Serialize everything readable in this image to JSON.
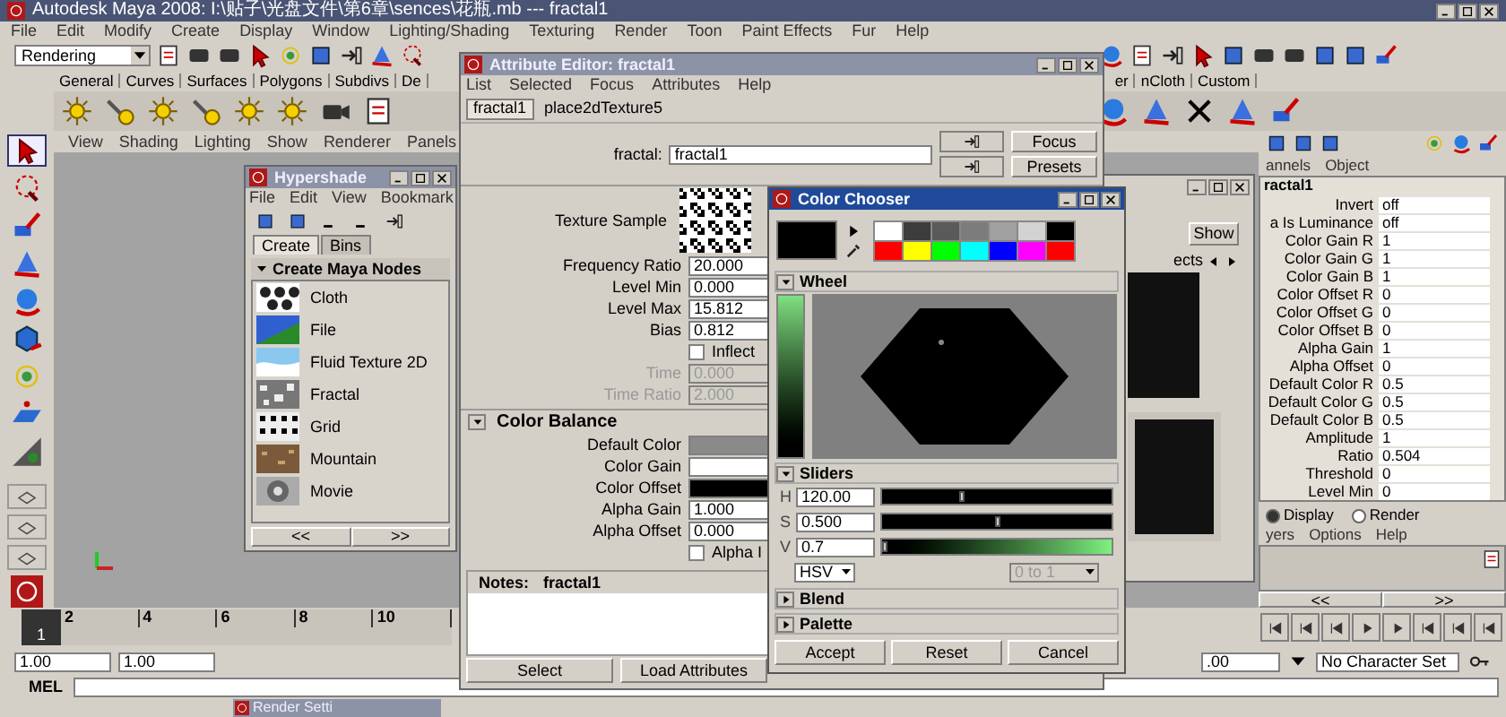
{
  "window": {
    "title": "Autodesk Maya 2008: I:\\贴子\\光盘文件\\第6章\\sences\\花瓶.mb  ---  fractal1"
  },
  "menu": [
    "File",
    "Edit",
    "Modify",
    "Create",
    "Display",
    "Window",
    "Lighting/Shading",
    "Texturing",
    "Render",
    "Toon",
    "Paint Effects",
    "Fur",
    "Help"
  ],
  "menu_set": {
    "value": "Rendering"
  },
  "shelf_tabs": [
    "General",
    "Curves",
    "Surfaces",
    "Polygons",
    "Subdivs",
    "De"
  ],
  "shelf_tabs_right": [
    "er",
    "nCloth",
    "Custom"
  ],
  "panel_menu": [
    "View",
    "Shading",
    "Lighting",
    "Show",
    "Renderer",
    "Panels"
  ],
  "hypershade": {
    "title": "Hypershade",
    "menu": [
      "File",
      "Edit",
      "View",
      "Bookmark"
    ],
    "tabs": [
      {
        "label": "Create",
        "selected": true
      },
      {
        "label": "Bins",
        "selected": false
      }
    ],
    "section": "Create Maya Nodes",
    "nodes": [
      {
        "label": "Cloth",
        "kind": "cloth"
      },
      {
        "label": "File",
        "kind": "file"
      },
      {
        "label": "Fluid Texture 2D",
        "kind": "fluid"
      },
      {
        "label": "Fractal",
        "kind": "fractal"
      },
      {
        "label": "Grid",
        "kind": "grid"
      },
      {
        "label": "Mountain",
        "kind": "mountain"
      },
      {
        "label": "Movie",
        "kind": "movie"
      }
    ],
    "pager": [
      "<<",
      ">>"
    ]
  },
  "attribute_editor": {
    "title": "Attribute Editor: fractal1",
    "menu": [
      "List",
      "Selected",
      "Focus",
      "Attributes",
      "Help"
    ],
    "tabs": [
      {
        "label": "fractal1",
        "selected": true
      },
      {
        "label": "place2dTexture5",
        "selected": false
      }
    ],
    "node_field": {
      "label": "fractal:",
      "value": "fractal1"
    },
    "buttons": [
      "Focus",
      "Presets"
    ],
    "texture_sample": "Texture Sample",
    "attributes": [
      {
        "kind": "field",
        "label": "Frequency Ratio",
        "value": "20.000",
        "disabled": false
      },
      {
        "kind": "field",
        "label": "Level Min",
        "value": "0.000",
        "disabled": false
      },
      {
        "kind": "field",
        "label": "Level Max",
        "value": "15.812",
        "disabled": false
      },
      {
        "kind": "field",
        "label": "Bias",
        "value": "0.812",
        "disabled": false
      },
      {
        "kind": "checkbox",
        "label": "Inflect",
        "checked": false
      },
      {
        "kind": "field",
        "label": "Time",
        "value": "0.000",
        "disabled": true
      },
      {
        "kind": "field",
        "label": "Time Ratio",
        "value": "2.000",
        "disabled": true
      }
    ],
    "color_balance": {
      "title": "Color Balance",
      "expanded": true,
      "rows": [
        {
          "kind": "color",
          "label": "Default Color",
          "color": "#8a8a8a"
        },
        {
          "kind": "color",
          "label": "Color Gain",
          "color": "#ffffff"
        },
        {
          "kind": "color",
          "label": "Color Offset",
          "color": "#000000"
        },
        {
          "kind": "field",
          "label": "Alpha Gain",
          "value": "1.000",
          "disabled": false
        },
        {
          "kind": "field",
          "label": "Alpha Offset",
          "value": "0.000",
          "disabled": false
        },
        {
          "kind": "checkbox",
          "label": "Alpha I",
          "checked": false
        }
      ]
    },
    "notes": {
      "label": "Notes:",
      "node": "fractal1"
    },
    "footer_buttons": [
      "Select",
      "Load Attributes"
    ]
  },
  "color_chooser": {
    "title": "Color Chooser",
    "swatches": [
      {
        "color": "#ffffff"
      },
      {
        "color": "#3c3c3c"
      },
      {
        "color": "#5a5a5a"
      },
      {
        "color": "#7c7c7c"
      },
      {
        "color": "#a0a0a0"
      },
      {
        "color": "#d2d2d2"
      },
      {
        "color": "#000000"
      },
      {
        "color": "#ff0000"
      },
      {
        "color": "#ffff00"
      },
      {
        "color": "#00ff00"
      },
      {
        "color": "#00ffff"
      },
      {
        "color": "#0000ff"
      },
      {
        "color": "#ff00ff"
      },
      {
        "color": "#ff0000"
      }
    ],
    "wheel": {
      "title": "Wheel",
      "expanded": true
    },
    "sliders_section": {
      "title": "Sliders",
      "expanded": true
    },
    "sliders": [
      {
        "label": "H",
        "value": "120.00",
        "level": 0.34,
        "kind": "plain"
      },
      {
        "label": "S",
        "value": "0.500",
        "level": 0.5,
        "kind": "plain"
      },
      {
        "label": "V",
        "value": "0.7",
        "level": 0.01,
        "kind": "gradient"
      }
    ],
    "mode": "HSV",
    "range": {
      "value": "0 to 1",
      "disabled": true
    },
    "collapsed_sections": [
      {
        "title": "Blend",
        "expanded": false
      },
      {
        "title": "Palette",
        "expanded": false
      }
    ],
    "buttons": [
      "Accept",
      "Reset",
      "Cancel"
    ]
  },
  "hidden_window": {
    "button": "Show",
    "tab": "ects"
  },
  "channel_box": {
    "menu": [
      "annels",
      "Object"
    ],
    "node": "ractal1",
    "rows": [
      {
        "label": "Invert",
        "value": "off"
      },
      {
        "label": "a Is Luminance",
        "value": "off"
      },
      {
        "label": "Color Gain R",
        "value": "1"
      },
      {
        "label": "Color Gain G",
        "value": "1"
      },
      {
        "label": "Color Gain B",
        "value": "1"
      },
      {
        "label": "Color Offset R",
        "value": "0"
      },
      {
        "label": "Color Offset G",
        "value": "0"
      },
      {
        "label": "Color Offset B",
        "value": "0"
      },
      {
        "label": "Alpha Gain",
        "value": "1"
      },
      {
        "label": "Alpha Offset",
        "value": "0"
      },
      {
        "label": "Default Color R",
        "value": "0.5"
      },
      {
        "label": "Default Color G",
        "value": "0.5"
      },
      {
        "label": "Default Color B",
        "value": "0.5"
      },
      {
        "label": "Amplitude",
        "value": "1"
      },
      {
        "label": "Ratio",
        "value": "0.504"
      },
      {
        "label": "Threshold",
        "value": "0"
      },
      {
        "label": "Level Min",
        "value": "0"
      }
    ]
  },
  "layer_editor": {
    "modes": [
      {
        "label": "Display",
        "selected": true
      },
      {
        "label": "Render",
        "selected": false
      }
    ],
    "menu": [
      "yers",
      "Options",
      "Help"
    ],
    "pager": [
      "<<",
      ">>"
    ]
  },
  "time_slider": {
    "current": "1",
    "level": 0,
    "ticks": [
      "2",
      "4",
      "6",
      "8",
      "10"
    ]
  },
  "range": {
    "start": "1.00",
    "start2": "1.00",
    "end": ".00"
  },
  "character_set": "No Character Set",
  "command_line": {
    "label": "MEL"
  },
  "minimized_window": {
    "title": "Render Setti"
  }
}
